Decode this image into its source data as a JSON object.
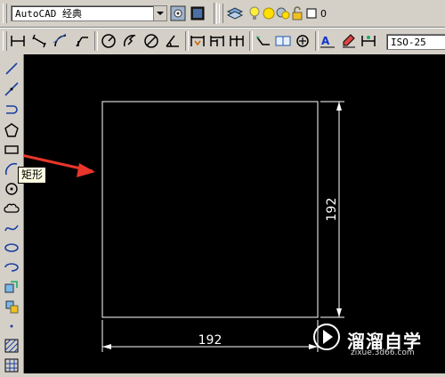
{
  "toolbar": {
    "workspace_value": "AutoCAD 经典",
    "layer_value": "0",
    "dimstyle_value": "ISO-25"
  },
  "tooltip": {
    "text": "矩形"
  },
  "drawing": {
    "horizontal_dim": "192",
    "vertical_dim": "192"
  },
  "watermark": {
    "text": "溜溜自学",
    "sub": "zixue.3d66.com"
  },
  "colors": {
    "canvas": "#000000",
    "arrow": "#e8362a",
    "ui": "#d4d0c8"
  }
}
